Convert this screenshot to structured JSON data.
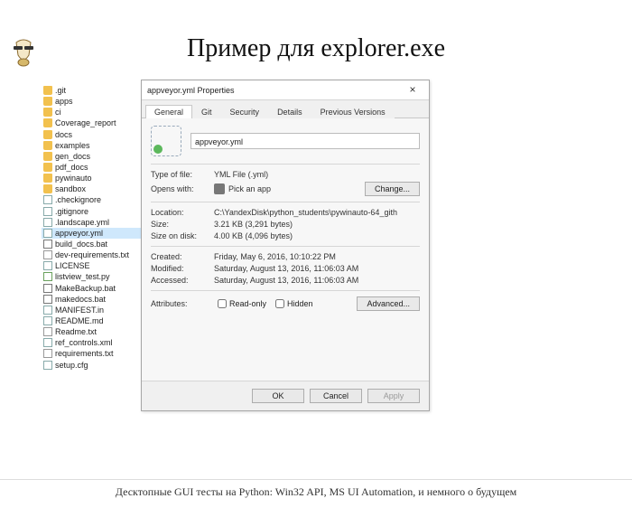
{
  "slide": {
    "title": "Пример для explorer.exe",
    "footer": "Десктопные GUI тесты на Python: Win32 API, MS UI Automation, и немного о будущем"
  },
  "files": [
    {
      "name": ".git",
      "type": "folder"
    },
    {
      "name": "apps",
      "type": "folder"
    },
    {
      "name": "ci",
      "type": "folder"
    },
    {
      "name": "Coverage_report",
      "type": "folder"
    },
    {
      "name": "docs",
      "type": "folder"
    },
    {
      "name": "examples",
      "type": "folder"
    },
    {
      "name": "gen_docs",
      "type": "folder"
    },
    {
      "name": "pdf_docs",
      "type": "folder"
    },
    {
      "name": "pywinauto",
      "type": "folder"
    },
    {
      "name": "sandbox",
      "type": "folder"
    },
    {
      "name": ".checkignore",
      "type": "file"
    },
    {
      "name": ".gitignore",
      "type": "file"
    },
    {
      "name": ".landscape.yml",
      "type": "file"
    },
    {
      "name": "appveyor.yml",
      "type": "file",
      "selected": true
    },
    {
      "name": "build_docs.bat",
      "type": "bat"
    },
    {
      "name": "dev-requirements.txt",
      "type": "txt"
    },
    {
      "name": "LICENSE",
      "type": "file"
    },
    {
      "name": "listview_test.py",
      "type": "py"
    },
    {
      "name": "MakeBackup.bat",
      "type": "bat"
    },
    {
      "name": "makedocs.bat",
      "type": "bat"
    },
    {
      "name": "MANIFEST.in",
      "type": "file"
    },
    {
      "name": "README.md",
      "type": "file"
    },
    {
      "name": "Readme.txt",
      "type": "txt"
    },
    {
      "name": "ref_controls.xml",
      "type": "file"
    },
    {
      "name": "requirements.txt",
      "type": "txt"
    },
    {
      "name": "setup.cfg",
      "type": "file"
    }
  ],
  "dialog": {
    "title": "appveyor.yml Properties",
    "tabs": [
      "General",
      "Git",
      "Security",
      "Details",
      "Previous Versions"
    ],
    "active_tab": "General",
    "filename": "appveyor.yml",
    "rows": {
      "type_of_file": {
        "label": "Type of file:",
        "value": "YML File (.yml)"
      },
      "opens_with": {
        "label": "Opens with:",
        "value": "Pick an app"
      },
      "change_btn": "Change...",
      "location": {
        "label": "Location:",
        "value": "C:\\YandexDisk\\python_students\\pywinauto-64_gith"
      },
      "size": {
        "label": "Size:",
        "value": "3.21 KB (3,291 bytes)"
      },
      "size_on_disk": {
        "label": "Size on disk:",
        "value": "4.00 KB (4,096 bytes)"
      },
      "created": {
        "label": "Created:",
        "value": "Friday, May 6, 2016, 10:10:22 PM"
      },
      "modified": {
        "label": "Modified:",
        "value": "Saturday, August 13, 2016, 11:06:03 AM"
      },
      "accessed": {
        "label": "Accessed:",
        "value": "Saturday, August 13, 2016, 11:06:03 AM"
      }
    },
    "attributes": {
      "label": "Attributes:",
      "readonly": "Read-only",
      "hidden": "Hidden",
      "advanced_btn": "Advanced..."
    },
    "buttons": {
      "ok": "OK",
      "cancel": "Cancel",
      "apply": "Apply"
    }
  }
}
